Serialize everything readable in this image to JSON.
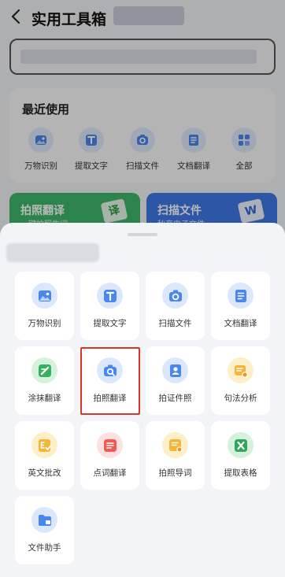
{
  "header": {
    "title": "实用工具箱"
  },
  "recent": {
    "title": "最近使用",
    "items": [
      {
        "label": "万物识别",
        "icon": "image-scan-icon"
      },
      {
        "label": "提取文字",
        "icon": "text-extract-icon"
      },
      {
        "label": "扫描文件",
        "icon": "camera-scan-icon"
      },
      {
        "label": "文档翻译",
        "icon": "document-translate-icon"
      },
      {
        "label": "全部",
        "icon": "grid-all-icon"
      }
    ]
  },
  "promos": [
    {
      "title": "拍照翻译",
      "subtitle": "一键拍照生词",
      "badge": "译"
    },
    {
      "title": "扫描文件",
      "subtitle": "秒变电子文件",
      "badge": "W"
    }
  ],
  "tools": [
    {
      "label": "万物识别",
      "icon": "image-scan-icon"
    },
    {
      "label": "提取文字",
      "icon": "text-extract-icon"
    },
    {
      "label": "扫描文件",
      "icon": "camera-scan-icon"
    },
    {
      "label": "文档翻译",
      "icon": "document-translate-icon"
    },
    {
      "label": "涂抹翻译",
      "icon": "smear-translate-icon"
    },
    {
      "label": "拍照翻译",
      "icon": "photo-translate-icon"
    },
    {
      "label": "拍证件照",
      "icon": "id-photo-icon"
    },
    {
      "label": "句法分析",
      "icon": "syntax-analysis-icon"
    },
    {
      "label": "英文批改",
      "icon": "english-correct-icon"
    },
    {
      "label": "点词翻译",
      "icon": "word-translate-icon"
    },
    {
      "label": "拍照导词",
      "icon": "photo-import-words-icon"
    },
    {
      "label": "提取表格",
      "icon": "excel-extract-icon"
    },
    {
      "label": "文件助手",
      "icon": "file-assistant-icon"
    }
  ],
  "colors": {
    "accent_blue": "#3f78e6",
    "accent_green": "#3fb66a",
    "selection_red": "#d9352b"
  }
}
